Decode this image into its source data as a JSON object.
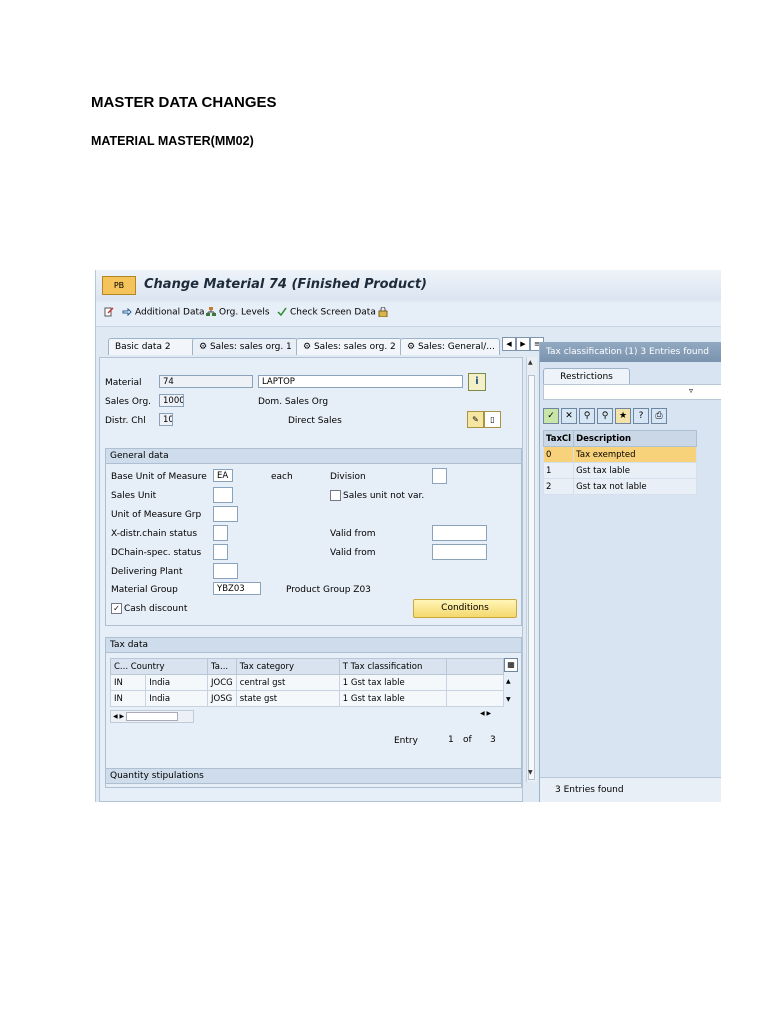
{
  "document": {
    "heading": "MASTER DATA CHANGES",
    "subheading": "MATERIAL MASTER(MM02)"
  },
  "window": {
    "app_icon_text": "PB",
    "title": "Change Material 74 (Finished Product)"
  },
  "toolbar": {
    "additional_data": "Additional Data",
    "org_levels": "Org. Levels",
    "check_screen_data": "Check Screen Data"
  },
  "tabs": [
    {
      "label": "Basic data 2"
    },
    {
      "label": "Sales: sales org. 1"
    },
    {
      "label": "Sales: sales org. 2"
    },
    {
      "label": "Sales: General/..."
    }
  ],
  "header_fields": {
    "material_label": "Material",
    "material_value": "74",
    "material_desc": "LAPTOP",
    "sales_org_label": "Sales Org.",
    "sales_org_value": "1000",
    "sales_org_desc": "Dom. Sales Org",
    "distr_chl_label": "Distr. Chl",
    "distr_chl_value": "10",
    "distr_chl_desc": "Direct Sales"
  },
  "general_data": {
    "title": "General data",
    "base_uom_label": "Base Unit of Measure",
    "base_uom_value": "EA",
    "base_uom_text": "each",
    "division_label": "Division",
    "sales_unit_label": "Sales Unit",
    "sales_unit_not_var_label": "Sales unit not var.",
    "uom_grp_label": "Unit of Measure Grp",
    "xdistr_label": "X-distr.chain status",
    "valid_from_label": "Valid from",
    "dchain_label": "DChain-spec. status",
    "valid_from_label2": "Valid from",
    "delivering_plant_label": "Delivering Plant",
    "material_group_label": "Material Group",
    "material_group_value": "YBZ03",
    "material_group_text": "Product Group Z03",
    "cash_discount_label": "Cash discount",
    "cash_discount_checked": true,
    "conditions_button": "Conditions"
  },
  "tax_data": {
    "title": "Tax data",
    "columns": [
      "C...",
      "Country",
      "Ta...",
      "Tax category",
      "T",
      "Tax classification"
    ],
    "rows": [
      {
        "c": "IN",
        "country": "India",
        "ta": "JOCG",
        "category": "central gst",
        "t": "1",
        "classification": "Gst tax lable"
      },
      {
        "c": "IN",
        "country": "India",
        "ta": "JOSG",
        "category": "state gst",
        "t": "1",
        "classification": "Gst tax lable"
      }
    ],
    "entry_label": "Entry",
    "entry_current": "1",
    "entry_of": "of",
    "entry_total": "3"
  },
  "quantity_stipulations": {
    "title": "Quantity stipulations"
  },
  "f4_help": {
    "header": "Tax classification (1)   3 Entries found",
    "restrictions_tab": "Restrictions",
    "columns": [
      "TaxCl",
      "Description"
    ],
    "rows": [
      {
        "code": "0",
        "description": "Tax exempted",
        "selected": true
      },
      {
        "code": "1",
        "description": "Gst tax lable",
        "selected": false
      },
      {
        "code": "2",
        "description": "Gst tax not lable",
        "selected": false
      }
    ],
    "footer": "3 Entries found"
  },
  "colors": {
    "window_bg": "#dfe9f4",
    "selected_row": "#f8d27a",
    "button_yellow": "#f5d86e",
    "popup_header": "#7a93ae"
  }
}
